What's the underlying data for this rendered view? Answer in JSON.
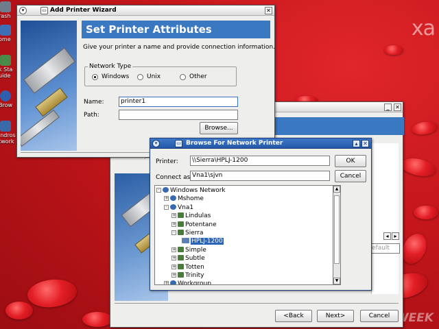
{
  "desktop": {
    "brand_mark": "xa",
    "watermark": "WEEK",
    "icons": [
      {
        "label": "rash",
        "icon": "trash-icon",
        "color": "#6f7c8c"
      },
      {
        "label": "ome",
        "icon": "home-icon",
        "color": "#3d6fb6"
      },
      {
        "label": "k Sta uide",
        "icon": "book-icon",
        "color": "#4a8b4a"
      },
      {
        "label": "Brow",
        "icon": "globe-icon",
        "color": "#2f5fae"
      },
      {
        "label": "indros twork",
        "icon": "network-icon",
        "color": "#3a6aa8"
      }
    ]
  },
  "wizard": {
    "title": "Add Printer Wizard",
    "heading": "Set Printer Attributes",
    "description": "Give your printer a name and provide connection information.",
    "network_type_label": "Network Type",
    "radios": [
      {
        "label": "Windows",
        "selected": true
      },
      {
        "label": "Unix",
        "selected": false
      },
      {
        "label": "Other",
        "selected": false
      }
    ],
    "name_label": "Name:",
    "name_value": "printer1",
    "path_label": "Path:",
    "path_value": "",
    "browse_button": "Browse..."
  },
  "back_wizard": {
    "back_button": "<Back",
    "next_button": "Next>",
    "cancel_button": "Cancel",
    "default_button": "efault"
  },
  "browse": {
    "title": "Browse For Network Printer",
    "printer_label": "Printer:",
    "printer_value": "\\\\Sierra\\HPLJ-1200",
    "ok_button": "OK",
    "connect_label": "Connect as:",
    "connect_value": "Vna1\\sjvn",
    "cancel_button": "Cancel",
    "tree": [
      {
        "label": "Windows Network",
        "level": 0,
        "expander": "-",
        "icon": "net",
        "selected": false
      },
      {
        "label": "Mshome",
        "level": 1,
        "expander": "+",
        "icon": "net",
        "selected": false
      },
      {
        "label": "Vna1",
        "level": 1,
        "expander": "-",
        "icon": "net",
        "selected": false
      },
      {
        "label": "Lindulas",
        "level": 2,
        "expander": "+",
        "icon": "host",
        "selected": false
      },
      {
        "label": "Potentane",
        "level": 2,
        "expander": "+",
        "icon": "host",
        "selected": false
      },
      {
        "label": "Sierra",
        "level": 2,
        "expander": "-",
        "icon": "host",
        "selected": false
      },
      {
        "label": "HPLJ-1200",
        "level": 3,
        "expander": "",
        "icon": "prn",
        "selected": true
      },
      {
        "label": "Simple",
        "level": 2,
        "expander": "+",
        "icon": "host",
        "selected": false
      },
      {
        "label": "Subtle",
        "level": 2,
        "expander": "+",
        "icon": "host",
        "selected": false
      },
      {
        "label": "Totten",
        "level": 2,
        "expander": "+",
        "icon": "host",
        "selected": false
      },
      {
        "label": "Trinity",
        "level": 2,
        "expander": "+",
        "icon": "host",
        "selected": false
      },
      {
        "label": "Workgroup",
        "level": 1,
        "expander": "+",
        "icon": "net",
        "selected": false
      }
    ]
  }
}
